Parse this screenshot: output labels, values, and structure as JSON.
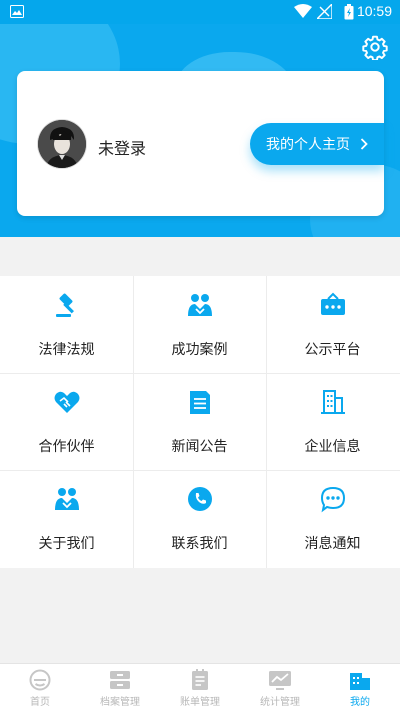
{
  "status_bar": {
    "time": "10:59",
    "icons": [
      "image-icon",
      "wifi-icon",
      "signal-icon",
      "battery-icon"
    ]
  },
  "header": {
    "accent_color": "#0aa8ee",
    "settings_icon": "gear-icon"
  },
  "profile": {
    "login_status": "未登录",
    "home_button_label": "我的个人主页"
  },
  "menu": [
    {
      "label": "法律法规",
      "icon": "gavel-icon"
    },
    {
      "label": "成功案例",
      "icon": "handshake-people-icon"
    },
    {
      "label": "公示平台",
      "icon": "bulletin-board-icon"
    },
    {
      "label": "合作伙伴",
      "icon": "heart-handshake-icon"
    },
    {
      "label": "新闻公告",
      "icon": "news-document-icon"
    },
    {
      "label": "企业信息",
      "icon": "building-icon"
    },
    {
      "label": "关于我们",
      "icon": "people-icon"
    },
    {
      "label": "联系我们",
      "icon": "phone-icon"
    },
    {
      "label": "消息通知",
      "icon": "chat-bubble-icon"
    }
  ],
  "tabbar": [
    {
      "label": "首页",
      "icon": "home-icon",
      "active": false
    },
    {
      "label": "档案管理",
      "icon": "archive-icon",
      "active": false
    },
    {
      "label": "账单管理",
      "icon": "bill-icon",
      "active": false
    },
    {
      "label": "统计管理",
      "icon": "statistics-icon",
      "active": false
    },
    {
      "label": "我的",
      "icon": "profile-icon",
      "active": true
    }
  ]
}
